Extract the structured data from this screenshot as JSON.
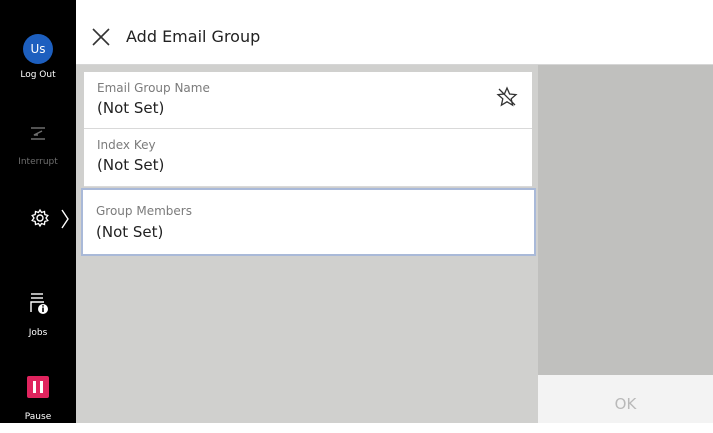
{
  "rail": {
    "avatar_initials": "Us",
    "logout_label": "Log Out",
    "interrupt_label": "Interrupt",
    "jobs_label": "Jobs",
    "pause_label": "Pause"
  },
  "header": {
    "title": "Add Email Group",
    "close_icon": "close-icon"
  },
  "fields": [
    {
      "label": "Email Group Name",
      "value": "(Not Set)"
    },
    {
      "label": "Index Key",
      "value": "(Not Set)"
    },
    {
      "label": "Group Members",
      "value": "(Not Set)"
    }
  ],
  "footer": {
    "ok_label": "OK"
  },
  "colors": {
    "rail_bg": "#000000",
    "avatar_bg": "#1d5fbf",
    "pause_bg": "#e0245e",
    "selected_border": "#a9b9d8"
  }
}
